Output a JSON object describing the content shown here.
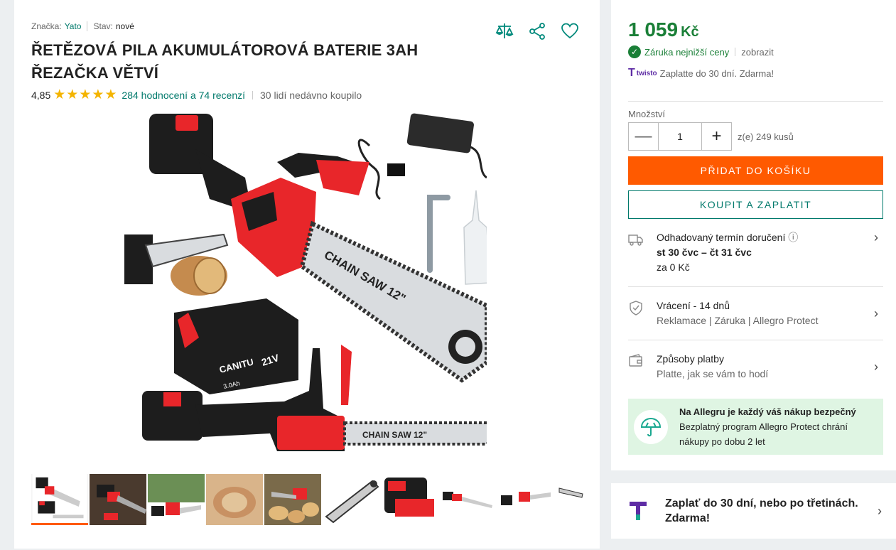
{
  "meta": {
    "brand_label": "Značka:",
    "brand_value": "Yato",
    "condition_label": "Stav:",
    "condition_value": "nové"
  },
  "product": {
    "title_line1": "ŘETĚZOVÁ PILA AKUMULÁTOROVÁ BATERIE 3AH",
    "title_line2": "ŘEZAČKA VĚTVÍ",
    "rating": "4,85",
    "stars": "★★★★★",
    "reviews": "284 hodnocení a 74 recenzí",
    "recent_buyers": "30 lidí nedávno koupilo"
  },
  "icons": {
    "compare": "compare-icon",
    "share": "share-icon",
    "favorite": "heart-icon"
  },
  "image_text": {
    "chainsaw_label": "CHAIN SAW 12\"",
    "battery_brand": "CANITU",
    "battery_volt": "21V",
    "battery_cap": "3.0Ah"
  },
  "thumbnails_count": 10,
  "buybox": {
    "price": "1 059",
    "currency": "Kč",
    "guarantee": "Záruka nejnižší ceny",
    "guarantee_show": "zobrazit",
    "twisto_logo": "twisto",
    "twisto_text": "Zaplatte do 30 dní. Zdarma!",
    "qty_label": "Množství",
    "qty_minus": "—",
    "qty_value": "1",
    "qty_plus": "+",
    "qty_stock": "z(e) 249 kusů",
    "add_to_cart": "PŘIDAT DO KOŠÍKU",
    "buy_now": "KOUPIT A ZAPLATIT"
  },
  "delivery": {
    "title": "Odhadovaný termín doručení",
    "info_icon": "ⓘ",
    "dates": "st 30 čvc – čt 31 čvc",
    "price": "za 0 Kč"
  },
  "returns": {
    "title": "Vrácení - 14 dnů",
    "sub": "Reklamace | Záruka | Allegro Protect"
  },
  "payment": {
    "title": "Způsoby platby",
    "sub": "Platte, jak se vám to hodí"
  },
  "protect": {
    "title": "Na Allegru je každý váš nákup bezpečný",
    "line1": "Bezplatný program Allegro Protect chrání",
    "line2": "nákupy po dobu 2 let"
  },
  "twisto_panel": {
    "line1": "Zaplať do 30 dní, nebo po třetinách.",
    "line2": "Zdarma!"
  },
  "chevron": "›",
  "colors": {
    "accent_orange": "#ff5a00",
    "accent_teal": "#00796b",
    "price_green": "#1a7f37",
    "twisto_purple": "#5e2ca5",
    "protect_bg": "#dff5e3"
  }
}
